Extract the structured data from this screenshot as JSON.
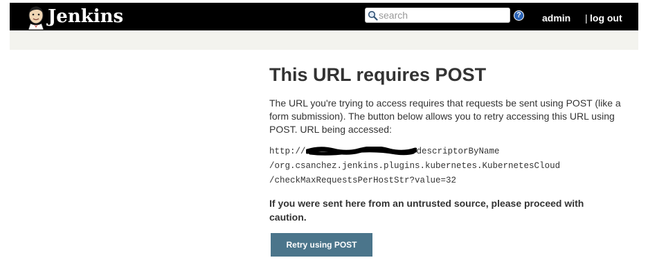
{
  "header": {
    "brand": "Jenkins",
    "search_placeholder": "search",
    "help_glyph": "?",
    "user": "admin",
    "separator": "|",
    "logout": "log out"
  },
  "main": {
    "title": "This URL requires POST",
    "description": "The URL you're trying to access requires that requests be sent using POST (like a form submission). The button below allows you to retry accessing this URL using POST. URL being accessed:",
    "url_prefix": "http://",
    "url_line1_suffix": "descriptorByName",
    "url_line2": "/org.csanchez.jenkins.plugins.kubernetes.KubernetesCloud",
    "url_line3": "/checkMaxRequestsPerHostStr?value=32",
    "warning": "If you were sent here from an untrusted source, please proceed with caution.",
    "retry_label": "Retry using POST"
  },
  "colors": {
    "header_bg": "#000000",
    "breadcrumb_bg": "#f3f3ee",
    "button_bg": "#4b758b",
    "help_blue": "#2a63b6"
  },
  "icons": {
    "logo": "jenkins-butler-logo",
    "search": "magnifier-icon",
    "help": "question-circle-icon"
  }
}
